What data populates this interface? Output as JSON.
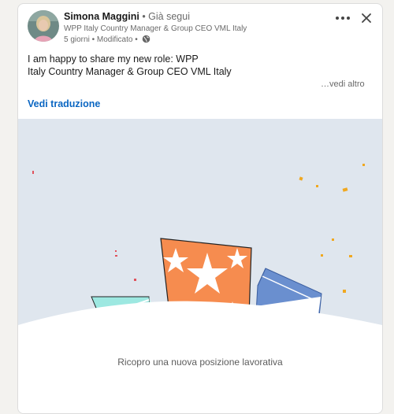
{
  "post": {
    "author_name": "Simona Maggini",
    "separator": " • ",
    "follow_status": "Già segui",
    "headline": "WPP Italy Country Manager & Group CEO VML Italy",
    "age": "5 giorni",
    "edited": "Modificato",
    "text_line1": "I am happy to share my new role: WPP",
    "text_line2": "Italy Country Manager & Group CEO VML Italy",
    "see_more": "…vedi altro",
    "translate": "Vedi traduzione"
  },
  "media": {
    "caption": "Ricopro una nuova posizione lavorativa"
  },
  "colors": {
    "link_blue": "#0a66c2",
    "media_bg": "#dfe6ee",
    "orange_box": "#f68c4f",
    "teal_box": "#9de8e1",
    "blue_box": "#6a8fcf"
  },
  "icons": {
    "more": "ellipsis-icon",
    "close": "close-icon",
    "visibility": "globe-icon"
  }
}
